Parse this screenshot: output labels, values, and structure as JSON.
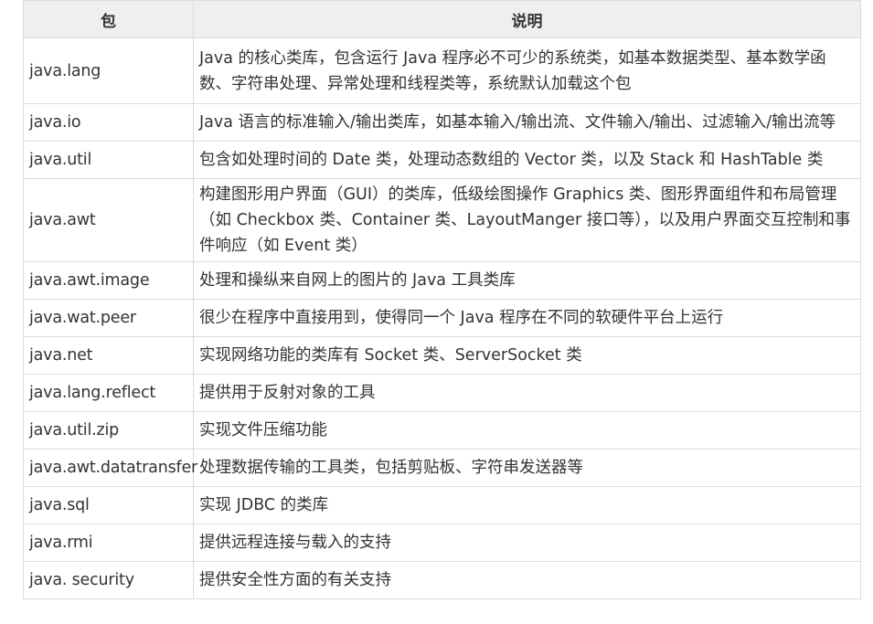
{
  "table": {
    "header": {
      "package": "包",
      "description": "说明"
    },
    "rows": [
      {
        "package": "java.lang",
        "description": "Java 的核心类库，包含运行 Java 程序必不可少的系统类，如基本数据类型、基本数学函数、字符串处理、异常处理和线程类等，系统默认加载这个包"
      },
      {
        "package": "java.io",
        "description": "Java 语言的标准输入/输出类库，如基本输入/输出流、文件输入/输出、过滤输入/输出流等"
      },
      {
        "package": "java.util",
        "description": "包含如处理时间的 Date 类，处理动态数组的 Vector 类，以及 Stack 和 HashTable 类"
      },
      {
        "package": "java.awt",
        "description": "构建图形用户界面（GUI）的类库，低级绘图操作 Graphics 类、图形界面组件和布局管理（如 Checkbox 类、Container 类、LayoutManger 接口等），以及用户界面交互控制和事件响应（如 Event 类）"
      },
      {
        "package": "java.awt.image",
        "description": "处理和操纵来自网上的图片的 Java 工具类库"
      },
      {
        "package": "java.wat.peer",
        "description": "很少在程序中直接用到，使得同一个 Java 程序在不同的软硬件平台上运行"
      },
      {
        "package": "java.net",
        "description": "实现网络功能的类库有 Socket 类、ServerSocket 类"
      },
      {
        "package": "java.lang.reflect",
        "description": "提供用于反射对象的工具"
      },
      {
        "package": "java.util.zip",
        "description": "实现文件压缩功能"
      },
      {
        "package": "java.awt.datatransfer",
        "description": "处理数据传输的工具类，包括剪贴板、字符串发送器等"
      },
      {
        "package": "java.sql",
        "description": "实现 JDBC 的类库"
      },
      {
        "package": "java.rmi",
        "description": "提供远程连接与载入的支持"
      },
      {
        "package": "java. security",
        "description": "提供安全性方面的有关支持"
      }
    ]
  }
}
